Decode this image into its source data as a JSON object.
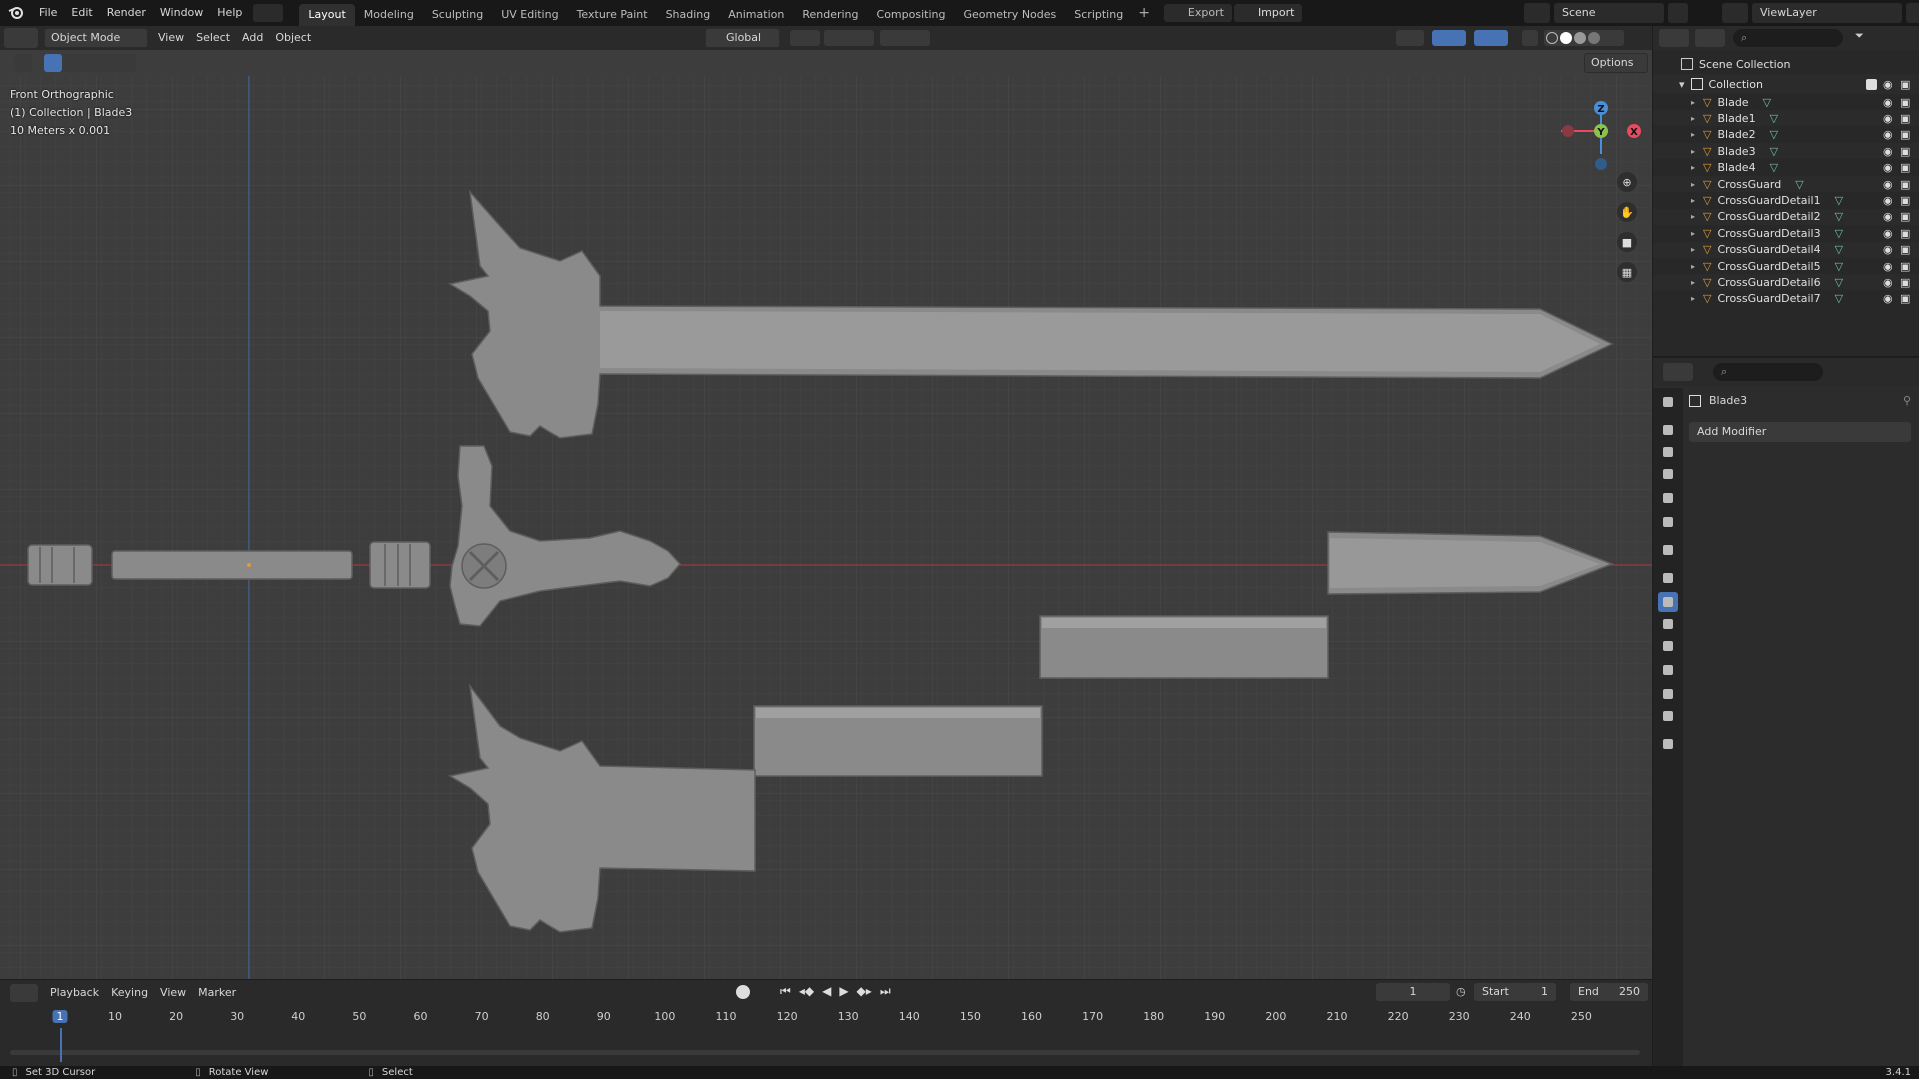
{
  "topbar": {
    "menus": [
      "File",
      "Edit",
      "Render",
      "Window",
      "Help"
    ],
    "workspaces": [
      "Layout",
      "Modeling",
      "Sculpting",
      "UV Editing",
      "Texture Paint",
      "Shading",
      "Animation",
      "Rendering",
      "Compositing",
      "Geometry Nodes",
      "Scripting"
    ],
    "active_workspace": "Layout",
    "export_label": "Export",
    "import_label": "Import",
    "scene_name": "Scene",
    "view_layer": "ViewLayer"
  },
  "viewport_header": {
    "mode": "Object Mode",
    "menus": [
      "View",
      "Select",
      "Add",
      "Object"
    ],
    "orientation": "Global",
    "options_label": "Options"
  },
  "viewport_overlay": {
    "view_name": "Front Orthographic",
    "collection_info": "(1) Collection | Blade3",
    "scale_info": "10 Meters x 0.001"
  },
  "gizmo": {
    "z": "Z",
    "y": "Y",
    "x": "X"
  },
  "outliner": {
    "scene_collection": "Scene Collection",
    "collection": "Collection",
    "objects": [
      "Blade",
      "Blade1",
      "Blade2",
      "Blade3",
      "Blade4",
      "CrossGuard",
      "CrossGuardDetail1",
      "CrossGuardDetail2",
      "CrossGuardDetail3",
      "CrossGuardDetail4",
      "CrossGuardDetail5",
      "CrossGuardDetail6",
      "CrossGuardDetail7"
    ]
  },
  "properties": {
    "object_name": "Blade3",
    "add_modifier": "Add Modifier"
  },
  "timeline": {
    "menus": [
      "Playback",
      "Keying",
      "View",
      "Marker"
    ],
    "current_frame": "1",
    "start_label": "Start",
    "start_value": "1",
    "end_label": "End",
    "end_value": "250",
    "ticks": [
      "1",
      "10",
      "20",
      "30",
      "40",
      "50",
      "60",
      "70",
      "80",
      "90",
      "100",
      "110",
      "120",
      "130",
      "140",
      "150",
      "160",
      "170",
      "180",
      "190",
      "200",
      "210",
      "220",
      "230",
      "240",
      "250"
    ]
  },
  "statusbar": {
    "hint1": "Set 3D Cursor",
    "hint2": "Rotate View",
    "hint3": "Select",
    "version": "3.4.1"
  },
  "colors": {
    "accent": "#4772b3",
    "axis_x": "#e84a5f",
    "axis_y": "#8bc34a",
    "axis_z": "#4a90d9",
    "object_orange": "#e39a3a",
    "mesh_green": "#6cc59d",
    "model_gray": "#8a8a8a"
  }
}
